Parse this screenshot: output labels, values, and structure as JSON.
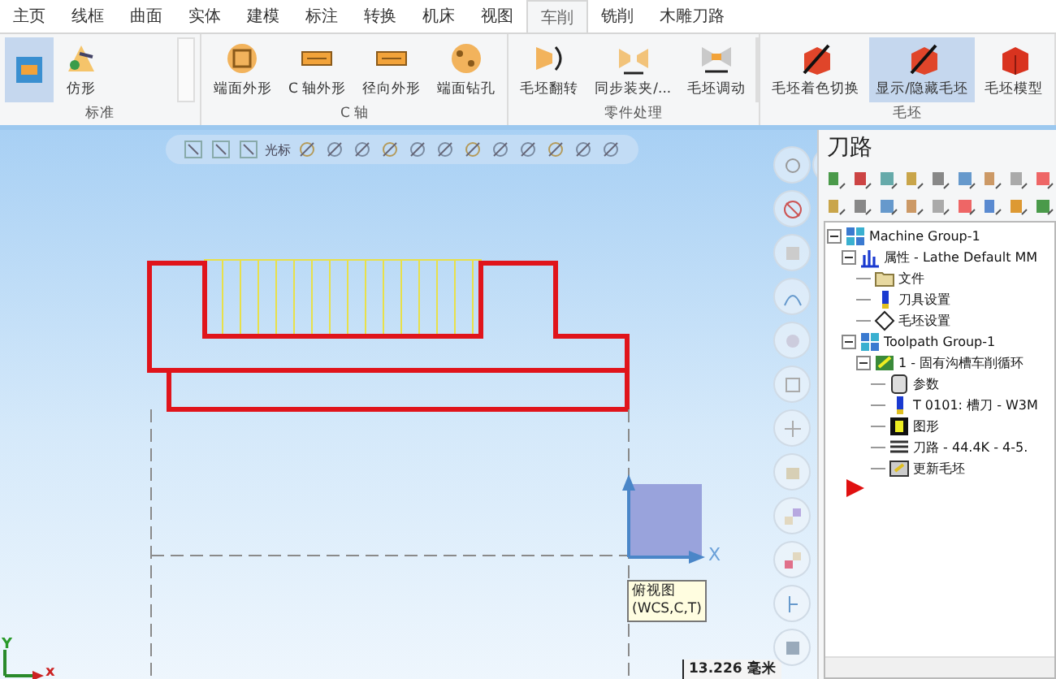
{
  "tabs": [
    {
      "label": "主页",
      "selected": false
    },
    {
      "label": "线框",
      "selected": false
    },
    {
      "label": "曲面",
      "selected": false
    },
    {
      "label": "实体",
      "selected": false
    },
    {
      "label": "建模",
      "selected": false
    },
    {
      "label": "标注",
      "selected": false
    },
    {
      "label": "转换",
      "selected": false
    },
    {
      "label": "机床",
      "selected": false
    },
    {
      "label": "视图",
      "selected": false
    },
    {
      "label": "车削",
      "selected": true
    },
    {
      "label": "铣削",
      "selected": false
    },
    {
      "label": "木雕刀路",
      "selected": false
    }
  ],
  "ribbon": {
    "groups": [
      {
        "caption": "标准",
        "scroll": true,
        "buttons": [
          {
            "kind": "lathe",
            "selected": true
          },
          {
            "label": "仿形",
            "kind": "profile",
            "selected": false
          }
        ]
      },
      {
        "caption": "C 轴",
        "scroll": false,
        "buttons": [
          {
            "label": "端面外形",
            "kind": "face",
            "selected": false
          },
          {
            "label": "C 轴外形",
            "kind": "bar",
            "selected": false
          },
          {
            "label": "径向外形",
            "kind": "bar",
            "selected": false
          },
          {
            "label": "端面钻孔",
            "kind": "drill",
            "selected": false
          }
        ]
      },
      {
        "caption": "零件处理",
        "scroll": true,
        "buttons": [
          {
            "label": "毛坯翻转",
            "kind": "flip",
            "selected": false
          },
          {
            "label": "同步装夹/...",
            "kind": "clamp",
            "selected": false
          },
          {
            "label": "毛坯调动",
            "kind": "shift",
            "selected": false
          }
        ]
      },
      {
        "caption": "毛坯",
        "scroll": false,
        "buttons": [
          {
            "label": "毛坯着色切换",
            "kind": "stock",
            "selected": false
          },
          {
            "label": "显示/隐藏毛坯",
            "kind": "stock",
            "selected": true
          },
          {
            "label": "毛坯模型",
            "kind": "model",
            "selected": false
          }
        ]
      }
    ]
  },
  "viewport": {
    "toolbar_label": "光标",
    "axis_label": "X",
    "tooltip": [
      "俯视图",
      "(WCS,C,T)"
    ],
    "corner_axes": [
      "Y",
      "x"
    ],
    "scale": "13.226 毫米"
  },
  "panel": {
    "title": "刀路",
    "tree": [
      {
        "label": "Machine Group-1",
        "kind": "group",
        "expanded": true,
        "children": [
          {
            "label": "属性 - Lathe Default MM",
            "kind": "props",
            "expanded": true,
            "children": [
              {
                "label": "文件",
                "kind": "folder"
              },
              {
                "label": "刀具设置",
                "kind": "tool"
              },
              {
                "label": "毛坯设置",
                "kind": "stock"
              }
            ]
          },
          {
            "label": "Toolpath Group-1",
            "kind": "group",
            "expanded": true,
            "children": [
              {
                "label": "1 - 固有沟槽车削循环",
                "kind": "op",
                "expanded": true,
                "children": [
                  {
                    "label": "参数",
                    "kind": "params"
                  },
                  {
                    "label": "T 0101: 槽刀 - W3M",
                    "kind": "tool"
                  },
                  {
                    "label": "图形",
                    "kind": "geometry"
                  },
                  {
                    "label": "刀路 - 44.4K - 4-5.",
                    "kind": "path"
                  },
                  {
                    "label": "更新毛坯",
                    "kind": "update"
                  }
                ]
              }
            ]
          }
        ]
      }
    ]
  }
}
